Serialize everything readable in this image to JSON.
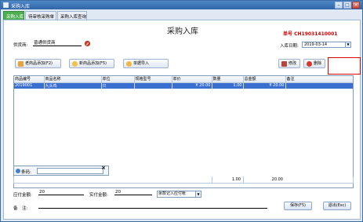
{
  "window": {
    "title": "采购入库"
  },
  "tabs": [
    {
      "label": "采购入库",
      "active": true
    },
    {
      "label": "待审核采购单",
      "active": false
    },
    {
      "label": "采购入库查询",
      "active": false
    }
  ],
  "header": {
    "page_title": "采购入库",
    "order_no": "单号 CH19031410001",
    "supplier_label": "供货商:",
    "supplier_value": "普通供货商",
    "date_label": "入库日期:",
    "date_value": "2019-03-14"
  },
  "toolbar": {
    "old_product_label": "老商品添加(F2)",
    "new_product_label": "新商品添加(F5)",
    "import_label": "单据导入",
    "modify_label": "修改",
    "delete_label": "删除"
  },
  "table": {
    "columns": [
      "商品编号",
      "商品名称",
      "单位",
      "规格型号",
      "单价",
      "数量",
      "总金额",
      "备注"
    ],
    "rows": [
      {
        "code": "2019001",
        "name": "九头鸡",
        "unit": "只",
        "spec": "",
        "price": "¥ 20.00",
        "qty": "1.00",
        "total": "¥ 20.00",
        "note": ""
      }
    ]
  },
  "barcode": {
    "label": "条码:"
  },
  "totals": {
    "qty": "1.00",
    "amount": "20.00"
  },
  "footer": {
    "payable_label": "应付金额:",
    "payable_value": "20",
    "paid_label": "实付金额:",
    "paid_value": "20",
    "account_option": "余款记入应付帐",
    "remark_label": "备　注:",
    "save_label": "保存(F5)",
    "exit_label": "退出(Esc)"
  },
  "colors": {
    "active_tab": "#4caf50",
    "order_no": "#d00000",
    "selected_row": "#3a6fd0",
    "highlight_rect": "#e00000"
  }
}
